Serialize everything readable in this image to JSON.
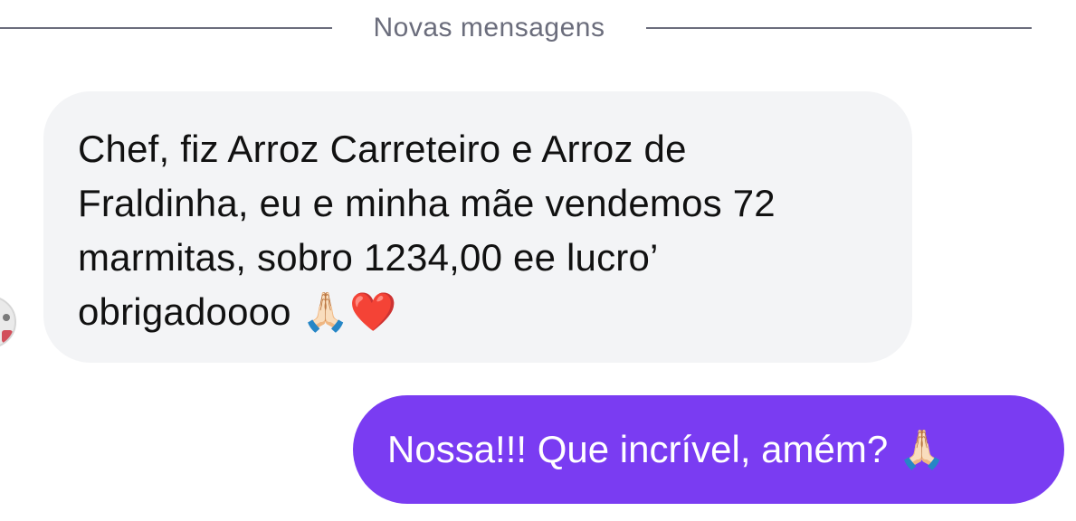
{
  "divider": {
    "label": "Novas mensagens"
  },
  "messages": [
    {
      "direction": "incoming",
      "text": "Chef, fiz Arroz Carreteiro e Arroz de\nFraldinha, eu e minha mãe vendemos 72\nmarmitas, sobro 1234,00 ee lucro’\nobrigadoooo 🙏🏻❤️"
    },
    {
      "direction": "outgoing",
      "text": "Nossa!!! Que incrível, amém? 🙏🏻"
    }
  ],
  "colors": {
    "incoming_bubble": "#f3f4f6",
    "outgoing_bubble": "#7a3cf2",
    "divider": "#6b6d7c"
  }
}
